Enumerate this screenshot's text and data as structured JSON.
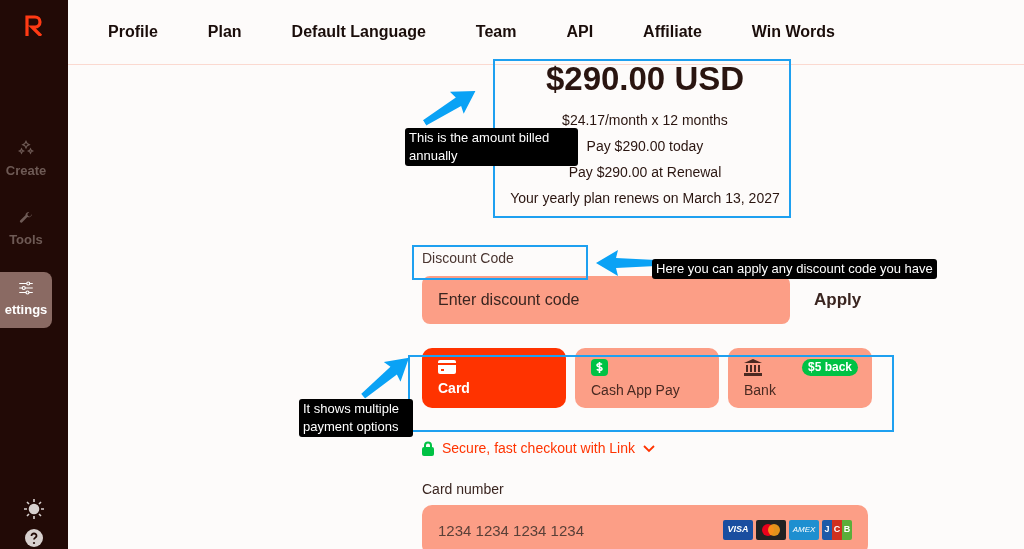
{
  "sidebar": {
    "items": [
      {
        "label": "Create",
        "selected": false
      },
      {
        "label": "Tools",
        "selected": false
      },
      {
        "label": "ettings",
        "selected": true
      }
    ]
  },
  "nav": {
    "tabs": [
      {
        "label": "Profile",
        "selected": false
      },
      {
        "label": "Plan",
        "selected": false
      },
      {
        "label": "Default Language",
        "selected": false
      },
      {
        "label": "Team",
        "selected": false
      },
      {
        "label": "API",
        "selected": false
      },
      {
        "label": "Affiliate",
        "selected": false
      },
      {
        "label": "Win Words",
        "selected": false
      }
    ]
  },
  "price": {
    "total": "$290.00 USD",
    "lines": [
      "$24.17/month x 12 months",
      "Pay $290.00 today",
      "Pay $290.00 at Renewal",
      "Your yearly plan renews on March 13, 2027"
    ]
  },
  "discount": {
    "label": "Discount Code",
    "placeholder": "Enter discount code",
    "apply": "Apply"
  },
  "payment_methods": [
    {
      "kind": "card",
      "label": "Card",
      "selected": true
    },
    {
      "kind": "cashapp",
      "label": "Cash App Pay",
      "selected": false
    },
    {
      "kind": "bank",
      "label": "Bank",
      "selected": false,
      "badge": "$5 back"
    }
  ],
  "link": "Secure, fast checkout with Link",
  "card_number": {
    "label": "Card number",
    "placeholder": "1234 1234 1234 1234",
    "brands": [
      "VISA",
      "AMEX",
      "J",
      "C",
      "B"
    ]
  },
  "annotations": [
    "This is the amount billed annually",
    "Here you can apply any discount code you have",
    "It shows multiple payment options"
  ]
}
